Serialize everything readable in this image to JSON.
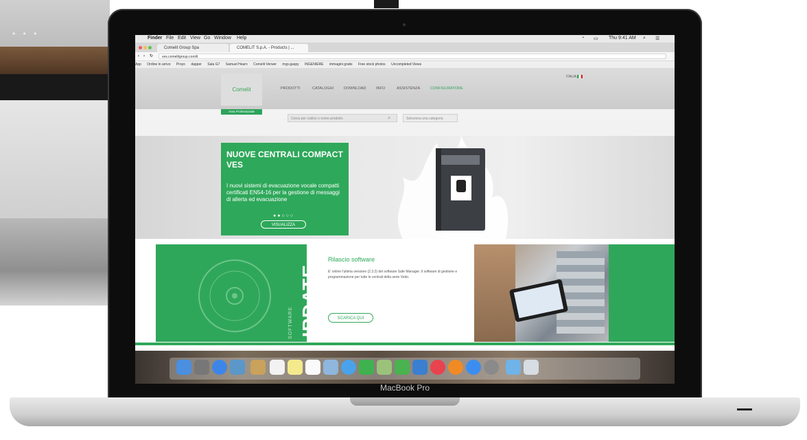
{
  "device": {
    "label": "MacBook Pro"
  },
  "menubar": {
    "items": [
      "Finder",
      "File",
      "Edit",
      "View",
      "Go",
      "Window",
      "Help"
    ],
    "clock": "Thu 9:41 AM"
  },
  "browser": {
    "tabs": [
      {
        "label": "Comelit Group Spa"
      },
      {
        "label": "COMELIT S.p.A. - Products | ..."
      }
    ],
    "url": "ves.comelitgroup.com/it",
    "bookmarks": [
      "App",
      "Ordine in arrivo",
      "Proyo",
      "dapper",
      "Sala G7",
      "Samuel Hearn",
      "Comelit Verwer",
      "myp.gaspy",
      "INGENIERE",
      "immagini gratis",
      "Free stock photos",
      "Uncompleted Views"
    ]
  },
  "site": {
    "logo": "Comelit",
    "lang": "ITALIA",
    "nav": [
      "PRODOTTI",
      "CATALOGHI",
      "DOWNLOAD",
      "INFO",
      "ASSISTENZA",
      "CONFIGURATORE"
    ],
    "nav_active_index": 5,
    "tag": "Area Professionale",
    "search_placeholder": "Cerca per codice o nome prodotto",
    "select_placeholder": "Seleziona una categoria"
  },
  "hero": {
    "title": "NUOVE CENTRALI COMPACT VES",
    "text": "I nuovi sistemi di evacuazione vocale compatti certificati EN54-16 per la gestione di messaggi di allerta ed evacuazione",
    "dots": "●●○○○",
    "button": "VISUALIZZA"
  },
  "update": {
    "big_word": "UPDATE",
    "small_word": "SOFTWARE",
    "title": "Rilascio software",
    "text": "E' online l'ultima versione (2.3.2) del software Safe Manager. Il software di gestione e programmazione per tutte le centrali della serie Vedo.",
    "button": "SCARICA QUI"
  },
  "dock": {
    "icons": [
      "finder",
      "launchpad",
      "safari",
      "photo-viewer",
      "notes",
      "calendar",
      "stickies",
      "reminders",
      "preview",
      "messages",
      "facetime",
      "maps",
      "numbers",
      "keynote",
      "itunes",
      "ibooks",
      "app-store",
      "system-preferences",
      "downloads-folder",
      "trash"
    ]
  },
  "colors": {
    "brand_green": "#2ea85a",
    "lid": "#0d0d0d"
  }
}
